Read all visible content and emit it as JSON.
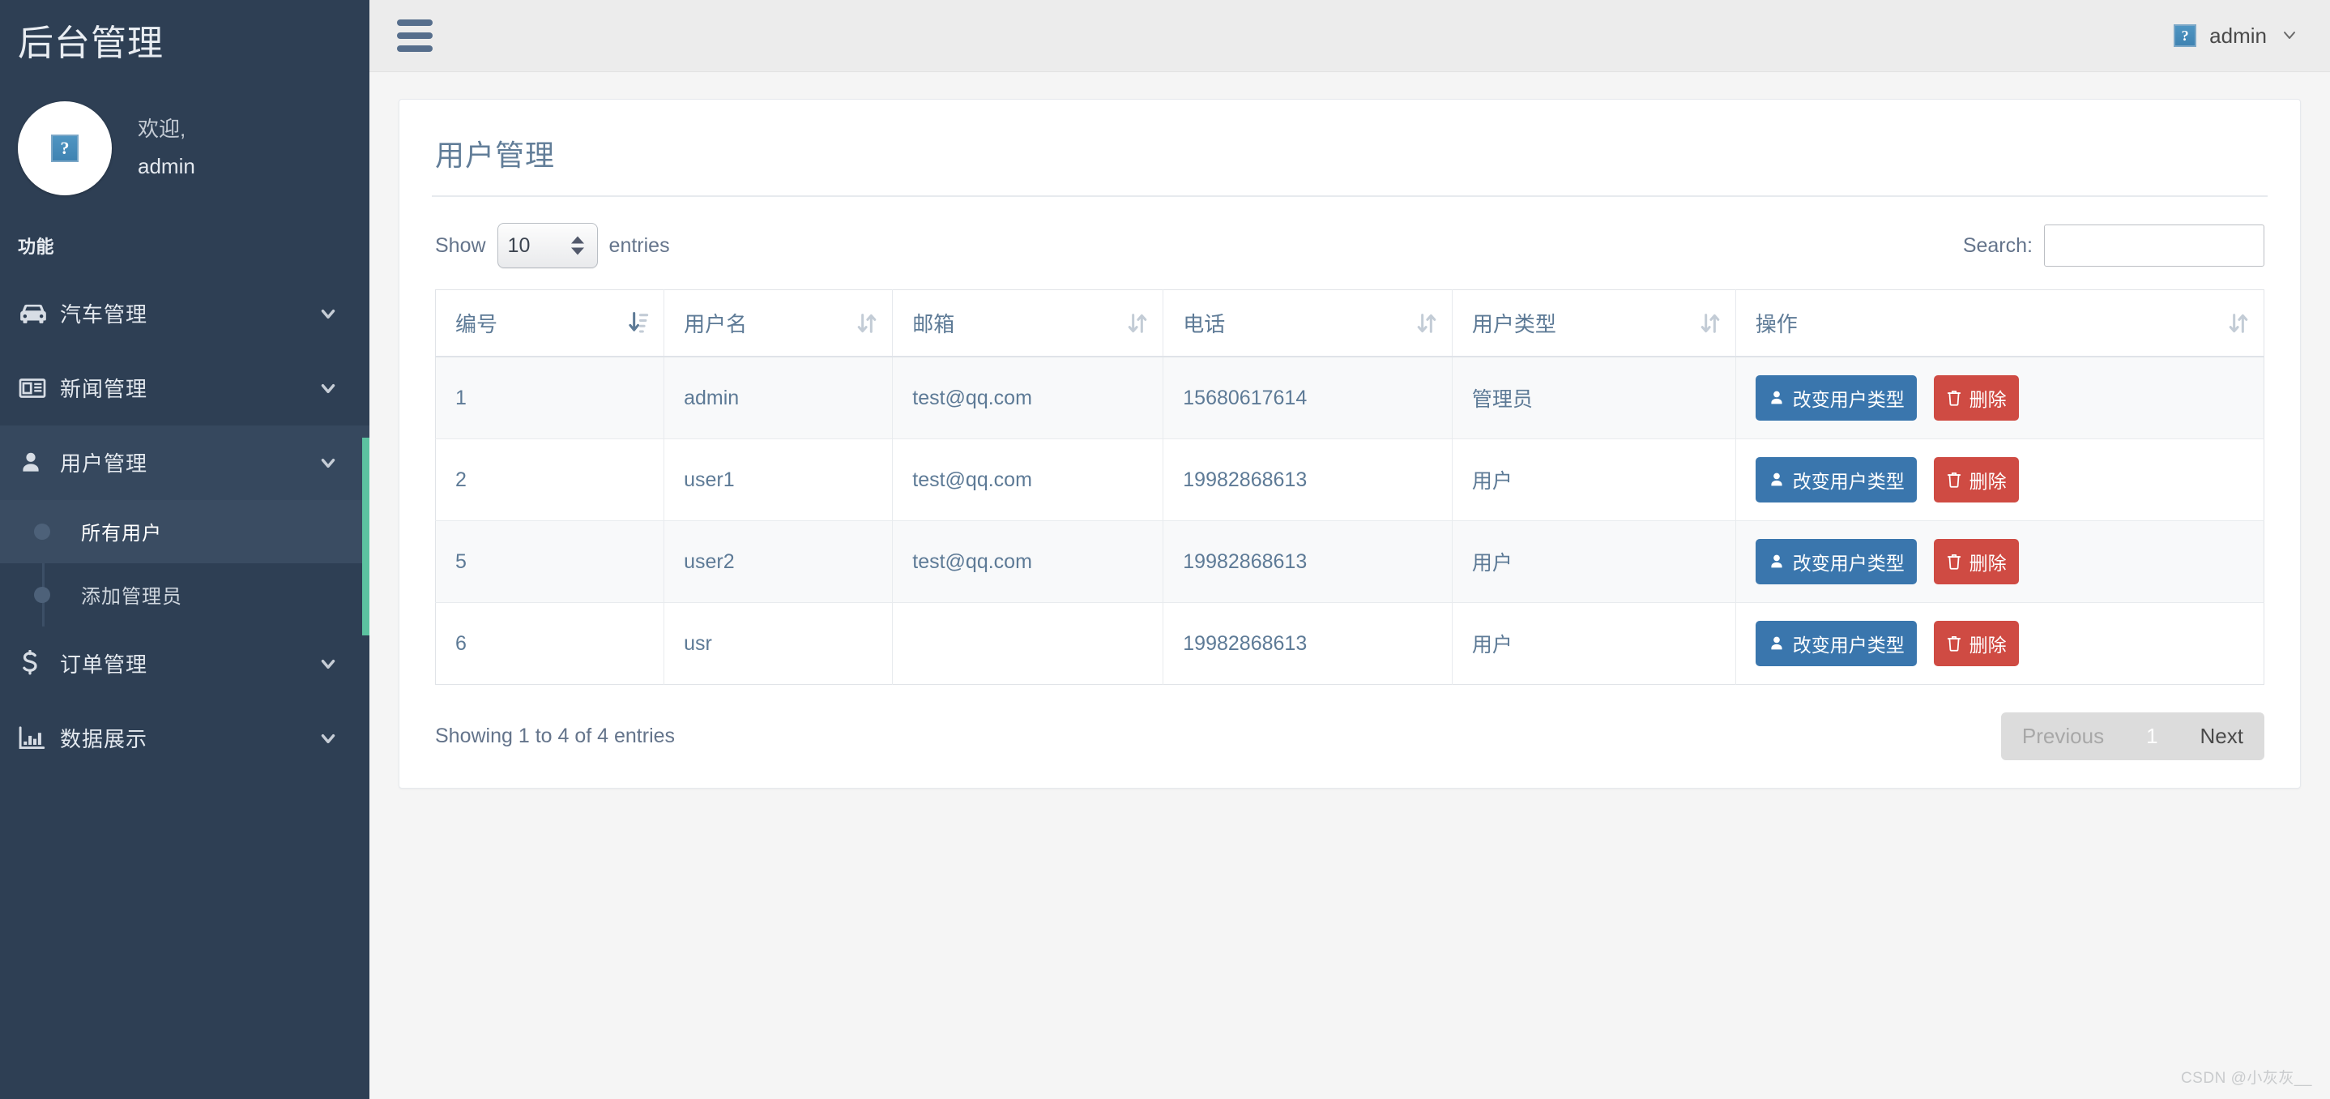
{
  "sidebar": {
    "brand": "后台管理",
    "avatar_icon": "broken-image-placeholder",
    "avatar_glyph": "?",
    "welcome_greeting": "欢迎,",
    "welcome_user": "admin",
    "section_label": "功能",
    "items": [
      {
        "label": "汽车管理",
        "icon": "car-icon",
        "chevron": "chevron-down-icon",
        "active": false
      },
      {
        "label": "新闻管理",
        "icon": "newspaper-icon",
        "chevron": "chevron-down-icon",
        "active": false
      },
      {
        "label": "用户管理",
        "icon": "user-icon",
        "chevron": "chevron-down-icon",
        "active": true
      },
      {
        "label": "订单管理",
        "icon": "dollar-icon",
        "chevron": "chevron-down-icon",
        "active": false
      },
      {
        "label": "数据展示",
        "icon": "bar-chart-icon",
        "chevron": "chevron-down-icon",
        "active": false
      }
    ],
    "subitems": [
      {
        "label": "所有用户",
        "active": true
      },
      {
        "label": "添加管理员",
        "active": false
      }
    ],
    "accent_color": "#5cc2a0",
    "background_color": "#2e3f54"
  },
  "navbar": {
    "menu_icon": "hamburger-icon",
    "avatar_icon": "broken-image-placeholder",
    "avatar_glyph": "?",
    "user_label": "admin",
    "chevron": "chevron-down-icon"
  },
  "card": {
    "title": "用户管理"
  },
  "table_controls": {
    "show_label": "Show",
    "entries_label": "entries",
    "page_length_value": "10",
    "search_label": "Search:",
    "search_value": "",
    "search_placeholder": ""
  },
  "table": {
    "columns": [
      {
        "label": "编号",
        "sort": "asc"
      },
      {
        "label": "用户名",
        "sort": "none"
      },
      {
        "label": "邮箱",
        "sort": "none"
      },
      {
        "label": "电话",
        "sort": "none"
      },
      {
        "label": "用户类型",
        "sort": "none"
      },
      {
        "label": "操作",
        "sort": "none"
      }
    ],
    "rows": [
      {
        "id": "1",
        "username": "admin",
        "email": "test@qq.com",
        "phone": "15680617614",
        "type": "管理员"
      },
      {
        "id": "2",
        "username": "user1",
        "email": "test@qq.com",
        "phone": "19982868613",
        "type": "用户"
      },
      {
        "id": "5",
        "username": "user2",
        "email": "test@qq.com",
        "phone": "19982868613",
        "type": "用户"
      },
      {
        "id": "6",
        "username": "usr",
        "email": "",
        "phone": "19982868613",
        "type": "用户"
      }
    ],
    "actions": {
      "change_type_label": "改变用户类型",
      "change_type_icon": "user-icon",
      "change_type_color": "#3a76ad",
      "delete_label": "删除",
      "delete_icon": "trash-icon",
      "delete_color": "#cf4b43"
    }
  },
  "footer": {
    "info": "Showing 1 to 4 of 4 entries",
    "previous_label": "Previous",
    "page_1_label": "1",
    "next_label": "Next"
  },
  "watermark": "CSDN @小灰灰__"
}
